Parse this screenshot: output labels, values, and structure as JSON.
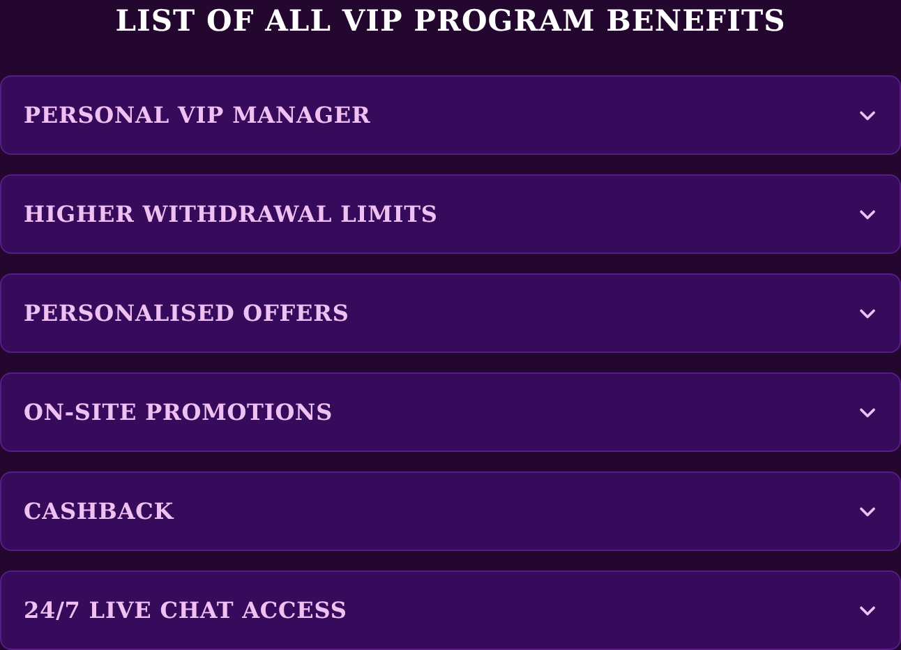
{
  "title": "LIST OF ALL VIP PROGRAM BENEFITS",
  "items": [
    {
      "label": "PERSONAL VIP MANAGER",
      "expanded": false
    },
    {
      "label": "HIGHER WITHDRAWAL LIMITS",
      "expanded": false
    },
    {
      "label": "PERSONALISED OFFERS",
      "expanded": false
    },
    {
      "label": "ON-SITE PROMOTIONS",
      "expanded": false
    },
    {
      "label": "CASHBACK",
      "expanded": false
    },
    {
      "label": "24/7 LIVE CHAT ACCESS",
      "expanded": false
    }
  ]
}
